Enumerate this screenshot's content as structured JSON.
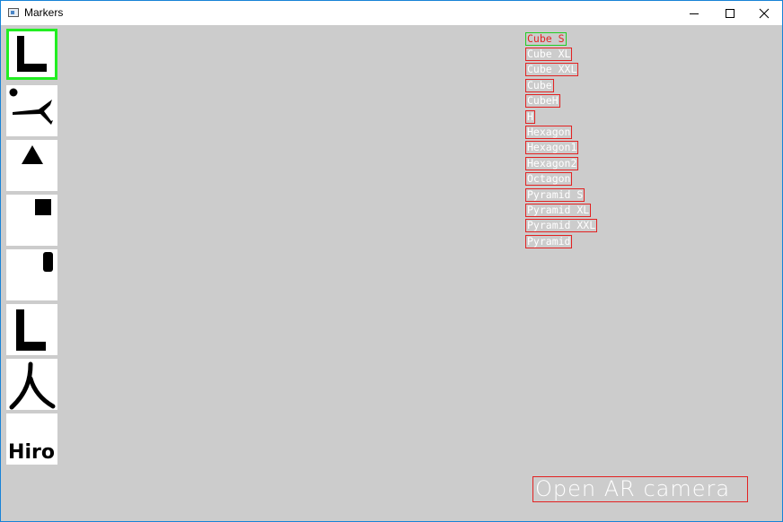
{
  "window": {
    "title": "Markers"
  },
  "markers": [
    {
      "icon": "letter-l-marker-icon",
      "selected": true
    },
    {
      "icon": "dot-arrow-marker-icon",
      "selected": false
    },
    {
      "icon": "triangle-marker-icon",
      "selected": false
    },
    {
      "icon": "square-marker-icon",
      "selected": false
    },
    {
      "icon": "bar-marker-icon",
      "selected": false
    },
    {
      "icon": "letter-l-marker-icon",
      "selected": false
    },
    {
      "icon": "kanji-person-marker-icon",
      "selected": false
    },
    {
      "icon": "hiro-marker-icon",
      "selected": false,
      "label": "Hiro"
    }
  ],
  "models": [
    "Cube S",
    "Cube XL",
    "Cube XXL",
    "Cube",
    "CubeH",
    "H",
    "Hexagon",
    "Hexagon1",
    "Hexagon2",
    "Octagon",
    "Pyramid S",
    "Pyramid XL",
    "Pyramid XXL",
    "Pyramid"
  ],
  "selected_model": "Cube S",
  "open_ar_button": "Open AR camera",
  "colors": {
    "background": "#cccccc",
    "selected_border": "#22ee22",
    "item_border": "#e22222",
    "item_text": "#ffffff"
  }
}
